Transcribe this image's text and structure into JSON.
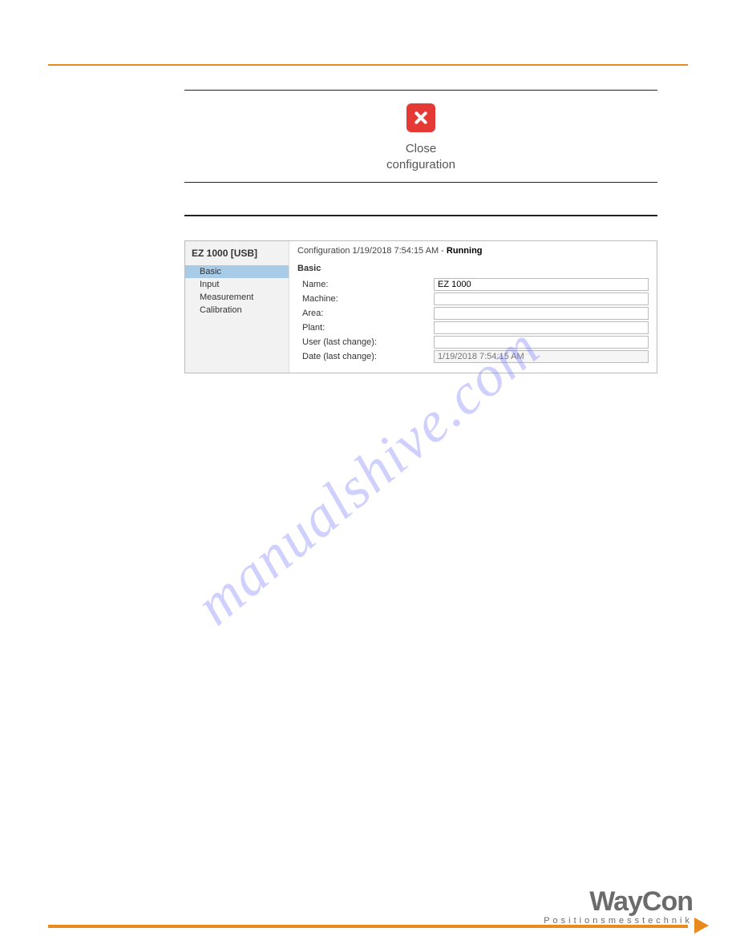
{
  "close_section": {
    "label_line1": "Close",
    "label_line2": "configuration"
  },
  "app": {
    "sidebar_title": "EZ 1000 [USB]",
    "sidebar_items": [
      "Basic",
      "Input",
      "Measurement",
      "Calibration"
    ],
    "status_prefix": "Configuration 1/19/2018 7:54:15 AM - ",
    "status_state": "Running",
    "section_label": "Basic",
    "fields": {
      "name": {
        "label": "Name:",
        "value": "EZ 1000"
      },
      "machine": {
        "label": "Machine:",
        "value": ""
      },
      "area": {
        "label": "Area:",
        "value": ""
      },
      "plant": {
        "label": "Plant:",
        "value": ""
      },
      "user": {
        "label": "User (last change):",
        "value": ""
      },
      "date": {
        "label": "Date (last change):",
        "value": "1/19/2018 7:54:15 AM"
      }
    }
  },
  "watermark": "manualshive.com",
  "brand": {
    "name": "WayCon",
    "tagline": "Positionsmesstechnik"
  }
}
